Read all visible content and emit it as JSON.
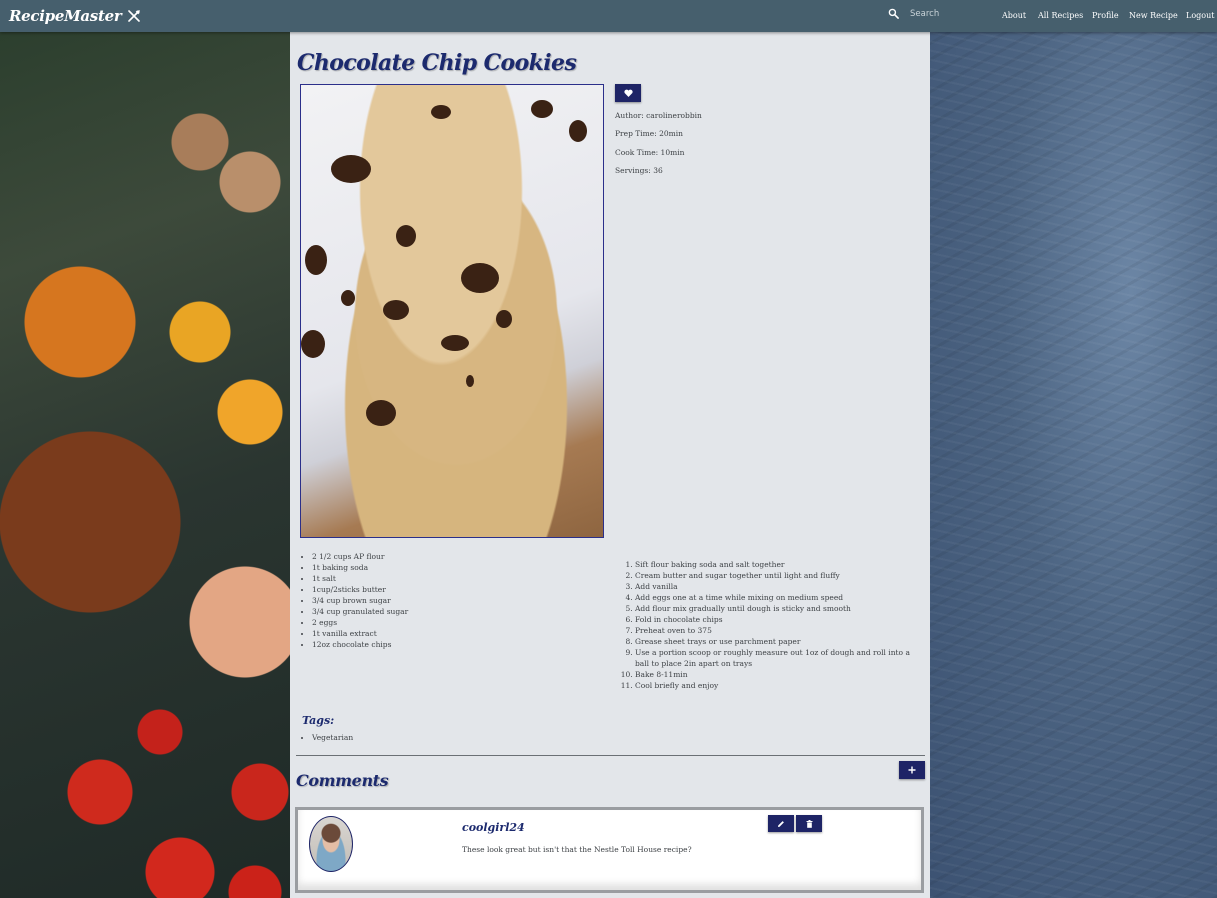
{
  "app": {
    "brand": "RecipeMaster"
  },
  "search": {
    "placeholder": "Search"
  },
  "nav": {
    "about": "About",
    "all_recipes": "All Recipes",
    "profile": "Profile",
    "new_recipe": "New Recipe",
    "logout": "Logout"
  },
  "recipe": {
    "title": "Chocolate Chip Cookies",
    "author": "Author: carolinerobbin",
    "prep_time": "Prep Time: 20min",
    "cook_time": "Cook Time: 10min",
    "servings": "Servings: 36",
    "ingredients": [
      "2 1/2 cups AP flour",
      "1t baking soda",
      "1t salt",
      "1cup/2sticks butter",
      "3/4 cup brown sugar",
      "3/4 cup granulated sugar",
      "2 eggs",
      "1t vanilla extract",
      "12oz chocolate chips"
    ],
    "steps": [
      "Sift flour baking soda and salt together",
      "Cream butter and sugar together until light and fluffy",
      "Add vanilla",
      "Add eggs one at a time while mixing on medium speed",
      "Add flour mix gradually until dough is sticky and smooth",
      "Fold in chocolate chips",
      "Preheat oven to 375",
      "Grease sheet trays or use parchment paper",
      "Use a portion scoop or roughly measure out 1oz of dough and roll into a ball to place 2in apart on trays",
      "Bake 8-11min",
      "Cool briefly and enjoy"
    ],
    "tags_title": "Tags:",
    "tags": [
      "Vegetarian"
    ]
  },
  "comments": {
    "title": "Comments",
    "items": [
      {
        "user": "coolgirl24",
        "text": "These look great but isn't that the Nestle Toll House recipe?"
      }
    ]
  },
  "icons": {
    "brand": "utensils-crossed-icon",
    "search": "search-icon",
    "favorite": "heart-icon",
    "add": "plus-icon",
    "edit": "pencil-icon",
    "delete": "trash-icon"
  },
  "colors": {
    "navbar": "#465f6d",
    "accent": "#1e2466",
    "heading": "#1c2a6e",
    "main_bg": "#e3e6ea"
  }
}
